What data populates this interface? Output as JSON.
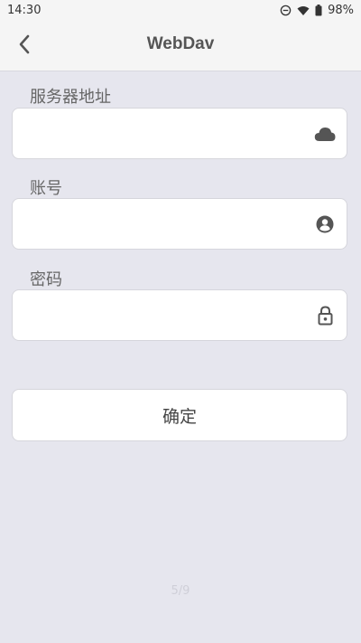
{
  "status_bar": {
    "time": "14:30",
    "battery": "98%",
    "icons": [
      "do-not-disturb-icon",
      "wifi-icon",
      "battery-icon"
    ]
  },
  "app_bar": {
    "title": "WebDav",
    "back_icon": "back-arrow-icon"
  },
  "form": {
    "server": {
      "label": "服务器地址",
      "value": "",
      "icon": "cloud-icon"
    },
    "account": {
      "label": "账号",
      "value": "",
      "icon": "account-circle-icon"
    },
    "password": {
      "label": "密码",
      "value": "",
      "icon": "lock-icon"
    },
    "confirm_label": "确定"
  },
  "footer": {
    "page_indicator": "5/9"
  },
  "colors": {
    "background": "#e6e6ee",
    "surface": "#ffffff",
    "text": "#555555",
    "icon": "#555555"
  }
}
